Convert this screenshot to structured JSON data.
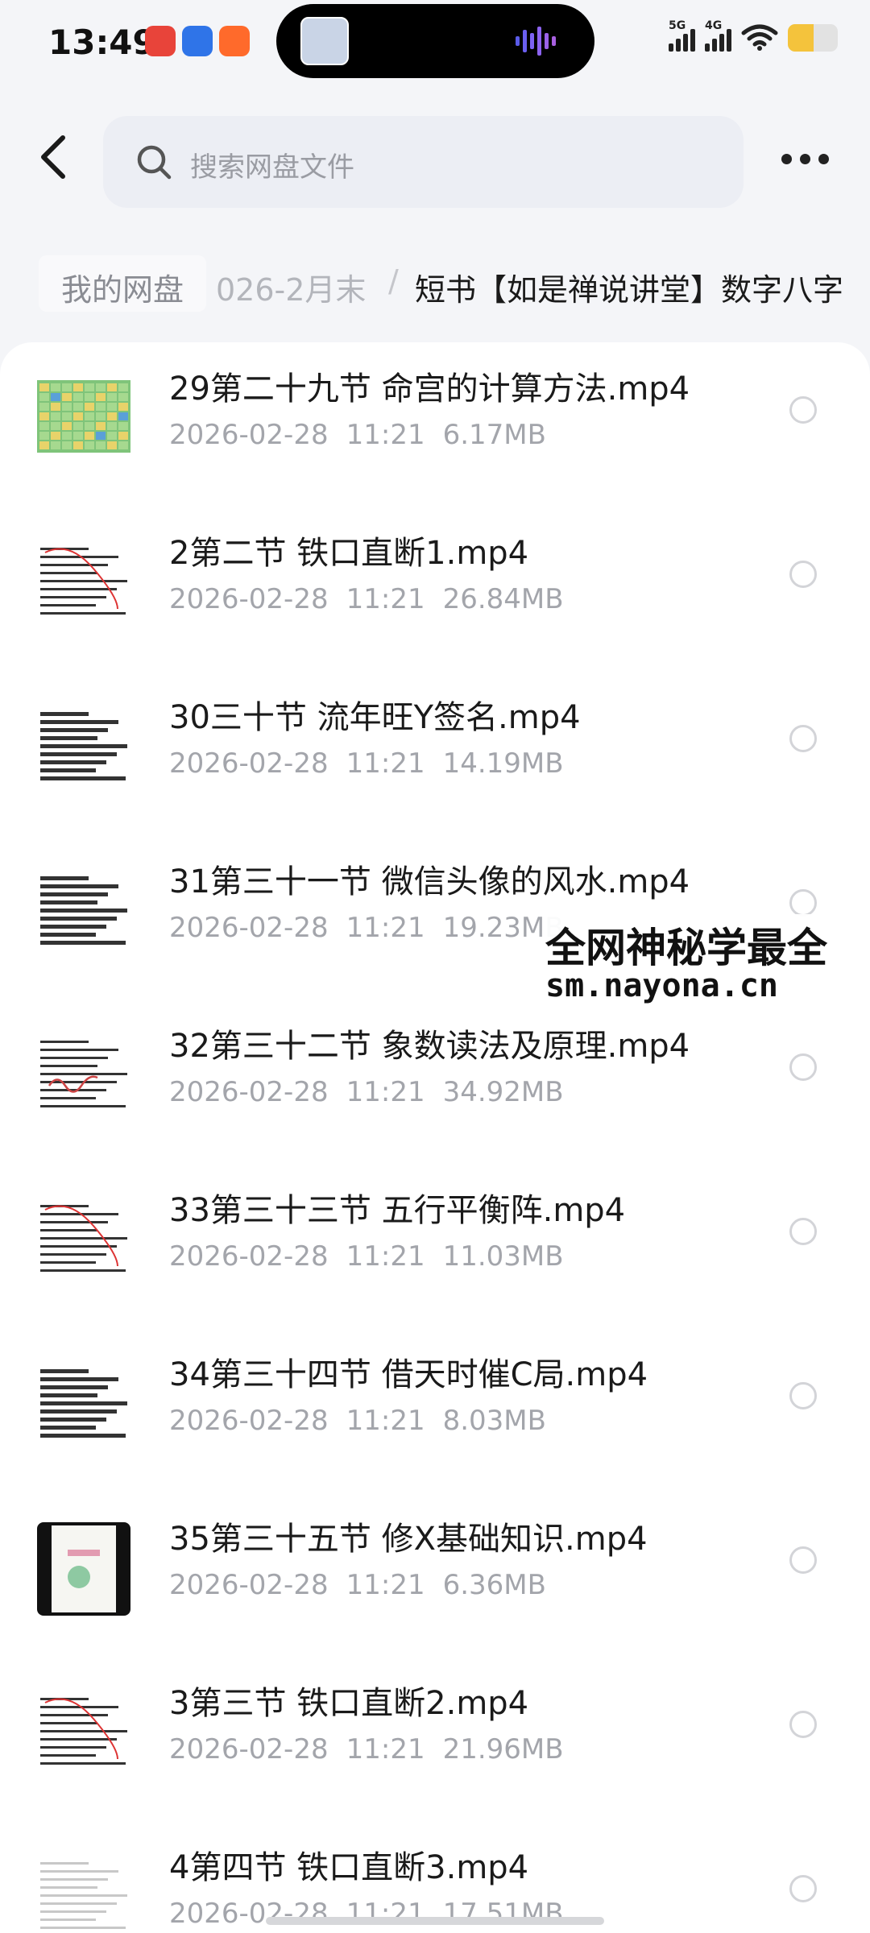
{
  "status_bar": {
    "time": "13:49",
    "network_1": "5G",
    "network_2": "4G",
    "battery_level": 0.52
  },
  "header": {
    "search_placeholder": "搜索网盘文件"
  },
  "breadcrumb": {
    "root": "我的网盘",
    "middle": "026-2月末",
    "separator": "/",
    "current": "短书【如是禅说讲堂】数字八字"
  },
  "files": [
    {
      "name": "29第二十九节 命宫的计算方法.mp4",
      "date": "2026-02-28",
      "time": "11:21",
      "size": "6.17MB",
      "thumb": "green-table"
    },
    {
      "name": "2第二节 铁口直断1.mp4",
      "date": "2026-02-28",
      "time": "11:21",
      "size": "26.84MB",
      "thumb": "text-red"
    },
    {
      "name": "30三十节 流年旺Y签名.mp4",
      "date": "2026-02-28",
      "time": "11:21",
      "size": "14.19MB",
      "thumb": "text-dense"
    },
    {
      "name": "31第三十一节 微信头像的风水.mp4",
      "date": "2026-02-28",
      "time": "11:21",
      "size": "19.23MB",
      "thumb": "text-dense"
    },
    {
      "name": "32第三十二节 象数读法及原理.mp4",
      "date": "2026-02-28",
      "time": "11:21",
      "size": "34.92MB",
      "thumb": "text-handwritten"
    },
    {
      "name": "33第三十三节 五行平衡阵.mp4",
      "date": "2026-02-28",
      "time": "11:21",
      "size": "11.03MB",
      "thumb": "text-red"
    },
    {
      "name": "34第三十四节 借天时催C局.mp4",
      "date": "2026-02-28",
      "time": "11:21",
      "size": "8.03MB",
      "thumb": "text-dense"
    },
    {
      "name": "35第三十五节 修X基础知识.mp4",
      "date": "2026-02-28",
      "time": "11:21",
      "size": "6.36MB",
      "thumb": "phone-frame"
    },
    {
      "name": "3第三节 铁口直断2.mp4",
      "date": "2026-02-28",
      "time": "11:21",
      "size": "21.96MB",
      "thumb": "text-red"
    },
    {
      "name": "4第四节 铁口直断3.mp4",
      "date": "2026-02-28",
      "time": "11:21",
      "size": "17.51MB",
      "thumb": "text-light"
    }
  ],
  "watermark": {
    "line1": "全网神秘学最全",
    "line2": "sm.nayona.cn"
  },
  "colors": {
    "background": "#f4f5f8",
    "card": "#ffffff",
    "meta_text": "#a3a5ab",
    "search_bg": "#eceef4",
    "battery": "#f4c33c"
  }
}
